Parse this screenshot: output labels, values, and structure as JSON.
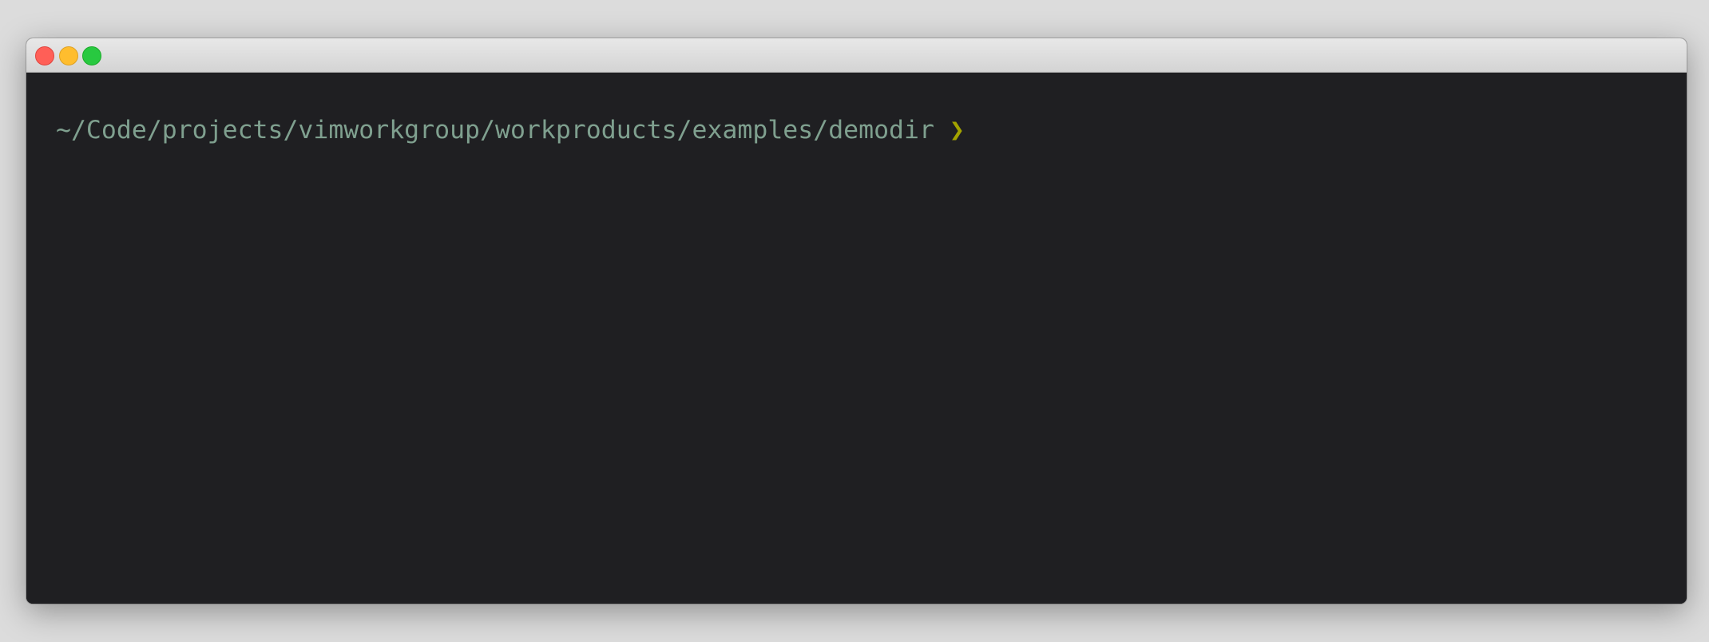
{
  "window": {
    "controls": [
      "close",
      "minimize",
      "maximize"
    ]
  },
  "terminal": {
    "prompt_path": "~/Code/projects/vimworkgroup/workproducts/examples/demodir",
    "prompt_symbol": "❯",
    "colors": {
      "path": "#7fa08f",
      "symbol": "#a3a300",
      "background": "#1f1f22"
    }
  }
}
